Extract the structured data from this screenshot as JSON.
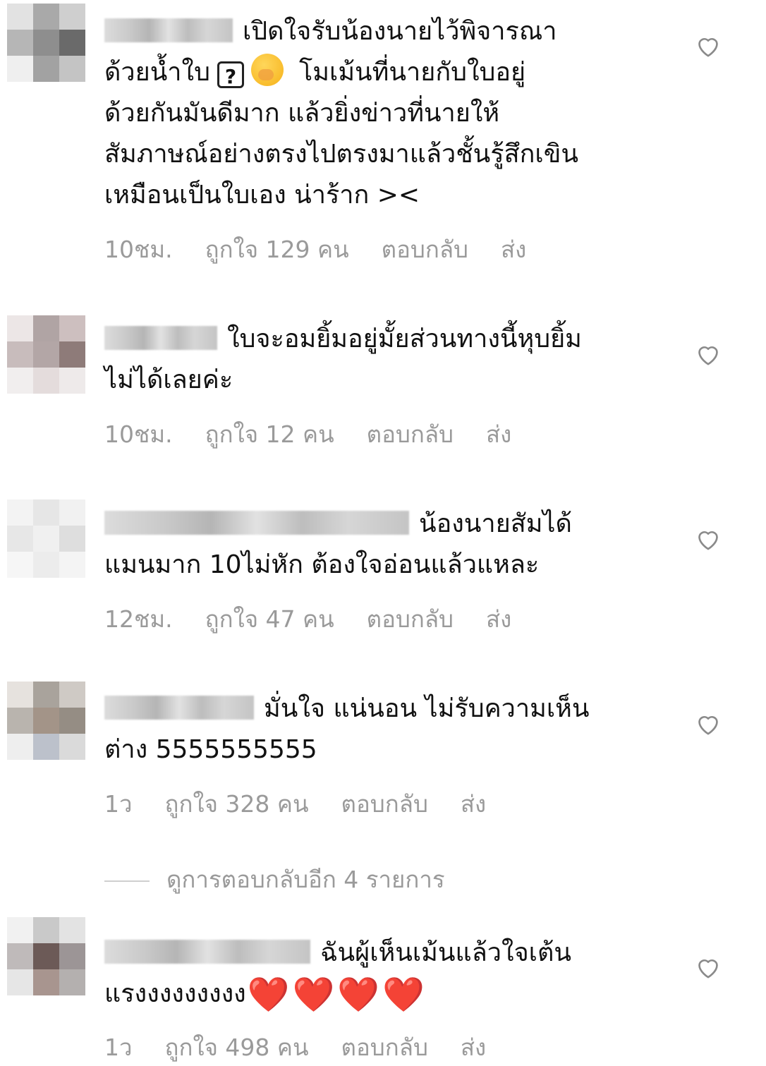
{
  "comments": [
    {
      "text_lines": [
        "เปิดใจรับน้องนายไว้พิจารณา",
        "ด้วยน้ำใบ",
        "โมเม้นที่นายกับใบอยู่",
        "ด้วยกันมันดีมาก แล้วยิ่งข่าวที่นายให้",
        "สัมภาษณ์อย่างตรงไปตรงมาแล้วชั้นรู้สึกเขิน",
        "เหมือนเป็นใบเอง น่าร้าก ><"
      ],
      "emoji_box": "?",
      "time": "10ชม.",
      "likes": "ถูกใจ 129 คน",
      "reply": "ตอบกลับ",
      "send": "ส่ง",
      "avatar_colors": [
        "#e2e2e2",
        "#a9a9a9",
        "#cfcfcf",
        "#b6b6b6",
        "#8e8e8e",
        "#6a6a6a",
        "#efefef",
        "#a2a2a2",
        "#c4c4c4"
      ]
    },
    {
      "text_lines": [
        "ใบจะอมยิ้มอยู่มั้ยส่วนทางนี้หุบยิ้ม",
        "ไม่ได้เลยค่ะ"
      ],
      "time": "10ชม.",
      "likes": "ถูกใจ 12 คน",
      "reply": "ตอบกลับ",
      "send": "ส่ง",
      "avatar_colors": [
        "#ece6e6",
        "#b0a4a4",
        "#cdbfbf",
        "#c8bcbc",
        "#b3a6a6",
        "#8e7b79",
        "#f1eeee",
        "#e4dcdc",
        "#eeeaea"
      ]
    },
    {
      "text_lines": [
        "น้องนายสัมได้",
        "แมนมาก 10ไม่หัก ต้องใจอ่อนแล้วแหละ"
      ],
      "time": "12ชม.",
      "likes": "ถูกใจ 47 คน",
      "reply": "ตอบกลับ",
      "send": "ส่ง",
      "avatar_colors": [
        "#f3f3f3",
        "#e6e6e6",
        "#f1f1f1",
        "#e7e7e7",
        "#f0f0f0",
        "#dedede",
        "#f6f6f6",
        "#ececec",
        "#f4f4f4"
      ]
    },
    {
      "text_lines": [
        "มั่นใจ แน่นอน ไม่รับความเห็น",
        "ต่าง 5555555555"
      ],
      "time": "1ว",
      "likes": "ถูกใจ 328 คน",
      "reply": "ตอบกลับ",
      "send": "ส่ง",
      "avatar_colors": [
        "#e6e2de",
        "#a9a39c",
        "#cfcac5",
        "#b9b4ae",
        "#a39488",
        "#958d84",
        "#eeeeee",
        "#bcc1cb",
        "#dadada"
      ]
    },
    {
      "text_lines": [
        "ฉันผู้เห็นเม้นแล้วใจเต้น",
        "แรงงงงงงงงง"
      ],
      "hearts": [
        "❤️",
        "❤️",
        "❤️",
        "❤️"
      ],
      "time": "1ว",
      "likes": "ถูกใจ 498 คน",
      "reply": "ตอบกลับ",
      "send": "ส่ง",
      "avatar_colors": [
        "#f1f1f1",
        "#c9c9c9",
        "#e3e3e3",
        "#bfbaba",
        "#6c5a57",
        "#9c9596",
        "#e6e6e6",
        "#a8958f",
        "#b4b0af"
      ]
    }
  ],
  "view_more_replies": "ดูการตอบกลับอีก 4 รายการ",
  "icons": {
    "like": "heart-outline-icon"
  },
  "colors": {
    "meta_text": "#9a9a9a",
    "heart_emoji": "#e0241c"
  }
}
